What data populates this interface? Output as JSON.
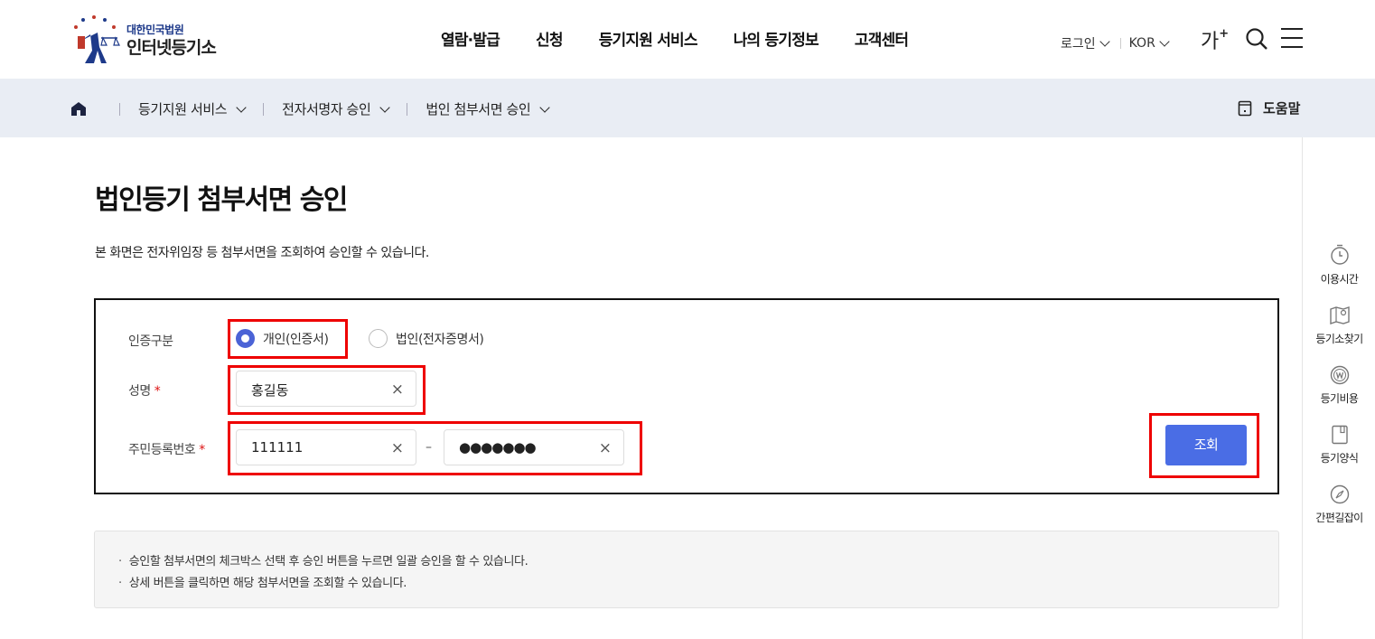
{
  "header": {
    "logo_small": "대한민국법원",
    "logo_big": "인터넷등기소",
    "nav": [
      "열람·발급",
      "신청",
      "등기지원 서비스",
      "나의 등기정보",
      "고객센터"
    ],
    "login": "로그인",
    "lang": "KOR",
    "font_size": "가",
    "font_plus": "+"
  },
  "breadcrumb": {
    "items": [
      "등기지원 서비스",
      "전자서명자 승인",
      "법인 첨부서면 승인"
    ],
    "help": "도움말"
  },
  "quickbar": [
    "이용시간",
    "등기소찾기",
    "등기비용",
    "등기양식",
    "간편길잡이"
  ],
  "page": {
    "title": "법인등기 첨부서면 승인",
    "description": "본 화면은 전자위임장 등 첨부서면을 조회하여 승인할 수 있습니다."
  },
  "form": {
    "auth_label": "인증구분",
    "auth_options": [
      "개인(인증서)",
      "법인(전자증명서)"
    ],
    "auth_selected": "개인(인증서)",
    "name_label": "성명",
    "name_value": "홍길동",
    "id_label": "주민등록번호",
    "id_front": "111111",
    "id_back": "●●●●●●●",
    "required_mark": "*",
    "dash": "–",
    "clear": "×",
    "search_button": "조회"
  },
  "notice": [
    "승인할 첨부서면의 체크박스 선택 후 승인 버튼을 누르면 일괄 승인을 할 수 있습니다.",
    "상세 버튼을 클릭하면 해당 첨부서면을 조회할 수 있습니다."
  ],
  "colors": {
    "accent": "#4a6de5",
    "highlight": "#e00000",
    "lnb_bg": "#e9edf4"
  }
}
